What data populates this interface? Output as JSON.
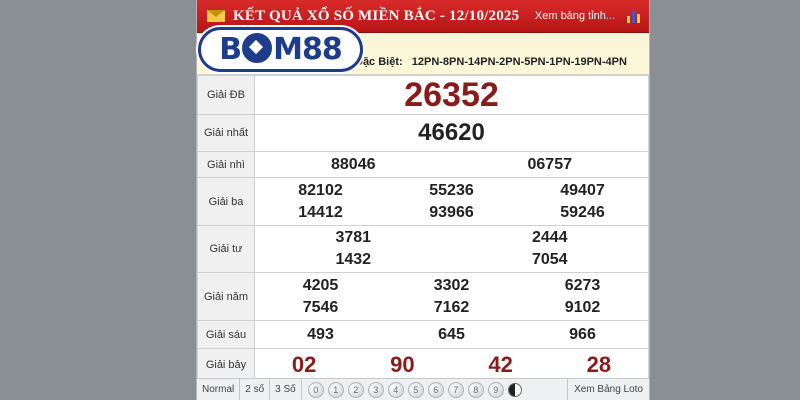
{
  "header": {
    "title": "KẾT QUẢ XỔ SỐ MIỀN BẮC - 12/10/2025",
    "view_province": "Xem bảng tỉnh...",
    "colors": {
      "bar": "#c91f1f",
      "accent": "#8b1a1a"
    }
  },
  "logo": {
    "text_left": "B",
    "text_right": "M88",
    "text_full": "BOM88"
  },
  "special": {
    "label": "Đặc Biệt:",
    "codes": "12PN-8PN-14PN-2PN-5PN-1PN-19PN-4PN"
  },
  "results": {
    "db": {
      "label": "Giải ĐB",
      "values": [
        "26352"
      ]
    },
    "nhat": {
      "label": "Giải nhất",
      "values": [
        "46620"
      ]
    },
    "nhi": {
      "label": "Giải nhì",
      "values": [
        "88046",
        "06757"
      ]
    },
    "ba": {
      "label": "Giải ba",
      "values": [
        "82102",
        "55236",
        "49407",
        "14412",
        "93966",
        "59246"
      ]
    },
    "tu": {
      "label": "Giải tư",
      "values": [
        "3781",
        "2444",
        "1432",
        "7054"
      ]
    },
    "nam": {
      "label": "Giải năm",
      "values": [
        "4205",
        "3302",
        "6273",
        "7546",
        "7162",
        "9102"
      ]
    },
    "sau": {
      "label": "Giải sáu",
      "values": [
        "493",
        "645",
        "966"
      ]
    },
    "bay": {
      "label": "Giải bảy",
      "values": [
        "02",
        "90",
        "42",
        "28"
      ]
    }
  },
  "footer": {
    "tabs": [
      "Normal",
      "2 số",
      "3 Số"
    ],
    "digits": [
      "0",
      "1",
      "2",
      "3",
      "4",
      "5",
      "6",
      "7",
      "8",
      "9"
    ],
    "loto": "Xem Bảng Loto"
  }
}
